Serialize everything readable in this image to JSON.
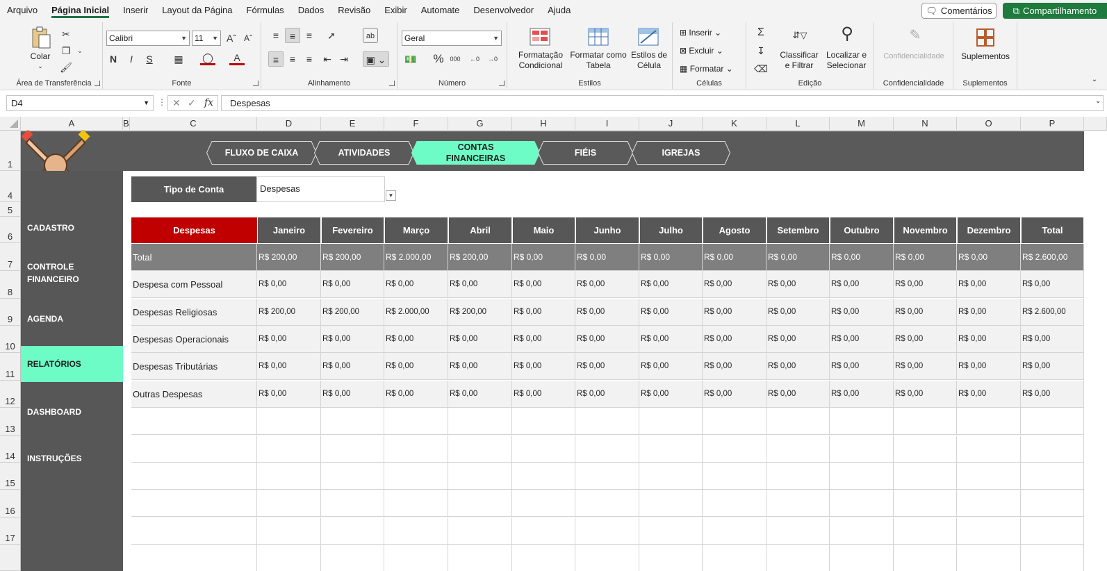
{
  "menu": {
    "items": [
      "Arquivo",
      "Página Inicial",
      "Inserir",
      "Layout da Página",
      "Fórmulas",
      "Dados",
      "Revisão",
      "Exibir",
      "Automate",
      "Desenvolvedor",
      "Ajuda"
    ],
    "comments_label": "Comentários",
    "share_label": "Compartilhamento"
  },
  "ribbon": {
    "clipboard": {
      "paste_label": "Colar",
      "group_label": "Área de Transferência"
    },
    "font": {
      "name": "Calibri",
      "size": "11",
      "group_label": "Fonte"
    },
    "alignment": {
      "group_label": "Alinhamento"
    },
    "number": {
      "format": "Geral",
      "group_label": "Número"
    },
    "styles": {
      "cond_format": "Formatação\nCondicional",
      "format_table": "Formatar como\nTabela",
      "cell_styles": "Estilos de\nCélula",
      "group_label": "Estilos"
    },
    "cells": {
      "insert": "Inserir",
      "delete": "Excluir",
      "format": "Formatar",
      "group_label": "Células"
    },
    "editing": {
      "sort": "Classificar\ne Filtrar",
      "find": "Localizar e\nSelecionar",
      "group_label": "Edição"
    },
    "sensitivity": {
      "label": "Confidencialidade",
      "group_label": "Confidencialidade"
    },
    "addins": {
      "label": "Suplementos",
      "group_label": "Suplementos"
    }
  },
  "formula_bar": {
    "name_box": "D4",
    "formula": "Despesas"
  },
  "columns": [
    "A",
    "B",
    "C",
    "D",
    "E",
    "F",
    "G",
    "H",
    "I",
    "J",
    "K",
    "L",
    "M",
    "N",
    "O",
    "P"
  ],
  "rows": [
    "1",
    "4",
    "5",
    "6",
    "7",
    "8",
    "9",
    "10",
    "11",
    "12",
    "13",
    "14",
    "15",
    "16",
    "17"
  ],
  "nav_tabs": [
    "FLUXO DE CAIXA",
    "ATIVIDADES",
    "CONTAS\nFINANCEIRAS",
    "FIÉIS",
    "IGREJAS"
  ],
  "active_tab_index": 2,
  "sidebar": {
    "items": [
      "CADASTRO",
      "CONTROLE\nFINANCEIRO",
      "AGENDA",
      "RELATÓRIOS",
      "DASHBOARD",
      "INSTRUÇÕES"
    ],
    "active_index": 3
  },
  "filter": {
    "label": "Tipo de Conta",
    "value": "Despesas"
  },
  "table": {
    "headers": [
      "Despesas",
      "Janeiro",
      "Fevereiro",
      "Março",
      "Abril",
      "Maio",
      "Junho",
      "Julho",
      "Agosto",
      "Setembro",
      "Outubro",
      "Novembro",
      "Dezembro",
      "Total"
    ],
    "total_row": [
      "Total",
      "R$ 200,00",
      "R$ 200,00",
      "R$ 2.000,00",
      "R$ 200,00",
      "R$ 0,00",
      "R$ 0,00",
      "R$ 0,00",
      "R$ 0,00",
      "R$ 0,00",
      "R$ 0,00",
      "R$ 0,00",
      "R$ 0,00",
      "R$ 2.600,00"
    ],
    "rows": [
      [
        "Despesa com Pessoal",
        "R$ 0,00",
        "R$ 0,00",
        "R$ 0,00",
        "R$ 0,00",
        "R$ 0,00",
        "R$ 0,00",
        "R$ 0,00",
        "R$ 0,00",
        "R$ 0,00",
        "R$ 0,00",
        "R$ 0,00",
        "R$ 0,00",
        "R$ 0,00"
      ],
      [
        "Despesas Religiosas",
        "R$ 200,00",
        "R$ 200,00",
        "R$ 2.000,00",
        "R$ 200,00",
        "R$ 0,00",
        "R$ 0,00",
        "R$ 0,00",
        "R$ 0,00",
        "R$ 0,00",
        "R$ 0,00",
        "R$ 0,00",
        "R$ 0,00",
        "R$ 2.600,00"
      ],
      [
        "Despesas Operacionais",
        "R$ 0,00",
        "R$ 0,00",
        "R$ 0,00",
        "R$ 0,00",
        "R$ 0,00",
        "R$ 0,00",
        "R$ 0,00",
        "R$ 0,00",
        "R$ 0,00",
        "R$ 0,00",
        "R$ 0,00",
        "R$ 0,00",
        "R$ 0,00"
      ],
      [
        "Despesas Tributárias",
        "R$ 0,00",
        "R$ 0,00",
        "R$ 0,00",
        "R$ 0,00",
        "R$ 0,00",
        "R$ 0,00",
        "R$ 0,00",
        "R$ 0,00",
        "R$ 0,00",
        "R$ 0,00",
        "R$ 0,00",
        "R$ 0,00",
        "R$ 0,00"
      ],
      [
        "Outras Despesas",
        "R$ 0,00",
        "R$ 0,00",
        "R$ 0,00",
        "R$ 0,00",
        "R$ 0,00",
        "R$ 0,00",
        "R$ 0,00",
        "R$ 0,00",
        "R$ 0,00",
        "R$ 0,00",
        "R$ 0,00",
        "R$ 0,00",
        "R$ 0,00"
      ]
    ]
  },
  "colors": {
    "accent_green": "#6efcc6",
    "header_red": "#c00000",
    "dark_gray": "#575757",
    "excel_green": "#1f7a3e"
  }
}
